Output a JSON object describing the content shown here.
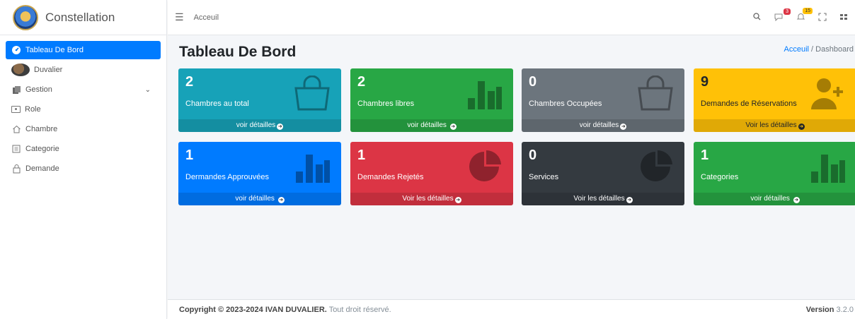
{
  "sidebar": {
    "brand": "Constellation",
    "items": [
      {
        "label": "Tableau De Bord"
      },
      {
        "label": "Duvalier"
      },
      {
        "label": "Gestion"
      },
      {
        "label": "Role"
      },
      {
        "label": "Chambre"
      },
      {
        "label": "Categorie"
      },
      {
        "label": "Demande"
      }
    ]
  },
  "header": {
    "home": "Acceuil",
    "messages_badge": "3",
    "notifications_badge": "15"
  },
  "page": {
    "title": "Tableau De Bord",
    "breadcrumb_home": "Acceuil",
    "breadcrumb_sep": "/",
    "breadcrumb_current": "Dashboard"
  },
  "tiles": [
    {
      "value": "2",
      "label": "Chambres au total",
      "link": "voir détailles",
      "color": "#17a2b8",
      "icon": "bag-icon"
    },
    {
      "value": "2",
      "label": "Chambres libres",
      "link": "voir détailles ",
      "color": "#28a745",
      "icon": "bar-chart-icon"
    },
    {
      "value": "0",
      "label": "Chambres Occupées",
      "link": "voir détailles",
      "color": "#6c757d",
      "icon": "bag-icon"
    },
    {
      "value": "9",
      "label": "Demandes de Réservations",
      "link": "Voir les détailles",
      "color": "#ffc107",
      "icon": "user-plus-icon"
    },
    {
      "value": "1",
      "label": "Dermandes Approuvées",
      "link": "voir détailles ",
      "color": "#007bff",
      "icon": "bar-chart-icon"
    },
    {
      "value": "1",
      "label": "Demandes Rejetés",
      "link": "Voir les détailles",
      "color": "#dc3545",
      "icon": "pie-chart-icon"
    },
    {
      "value": "0",
      "label": "Services",
      "link": "Voir les détailles",
      "color": "#343a40",
      "icon": "pie-chart-icon"
    },
    {
      "value": "1",
      "label": "Categories",
      "link": "voir détailles ",
      "color": "#28a745",
      "icon": "bar-chart-icon"
    }
  ],
  "footer": {
    "copyright_prefix": "Copyright © 2023-2024",
    "author": "IVAN DUVALIER.",
    "rights": "Tout droit réservé.",
    "version_label": "Version",
    "version_number": "3.2.0"
  }
}
